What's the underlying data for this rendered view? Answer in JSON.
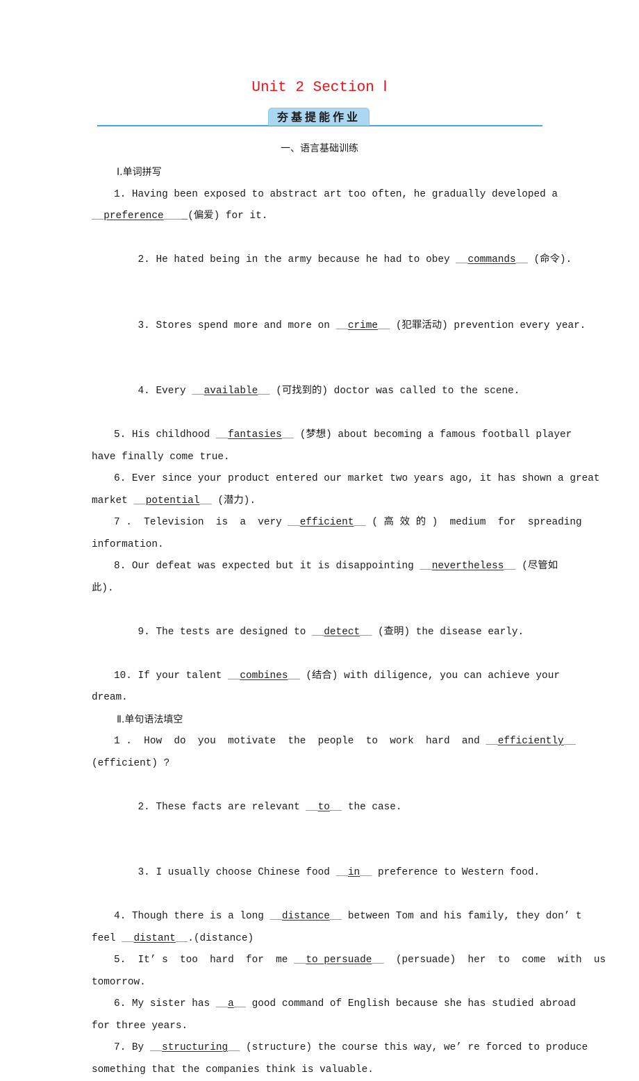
{
  "header": {
    "title": "Unit 2  Section Ⅰ",
    "banner": "夯基提能作业",
    "section_heading": "一、语言基础训练",
    "title_color": "#e8141b",
    "banner_color": "#a9d8f0",
    "rule_color": "#4aa8d8"
  },
  "part1": {
    "heading": "Ⅰ.单词拼写",
    "items": [
      {
        "pre": "1. Having been exposed to abstract art too often, he gradually developed a",
        "pre2": "",
        "answer": "preference",
        "post": "_(偏爱) for it."
      },
      {
        "pre": "2. He hated being in the army because he had to obey ",
        "answer": "commands",
        "post": " (命令)."
      },
      {
        "pre": "3. Stores spend more and more on ",
        "answer": "crime",
        "post": " (犯罪活动) prevention every year."
      },
      {
        "pre": "4. Every ",
        "answer": "available",
        "post": " (可找到的) doctor was called to the scene."
      },
      {
        "pre": "5. His childhood ",
        "answer": "fantasies",
        "post": " (梦想) about becoming a famous football player",
        "cont": "have finally come true."
      },
      {
        "pre": "6. Ever since your product entered our market two years ago, it has shown a great",
        "pre2": "market ",
        "answer": "potential",
        "post": " (潜力)."
      },
      {
        "pre": "7 .  Television  is  a  very ",
        "answer": "efficient",
        "post": " ( 高 效 的 )  medium  for  spreading",
        "cont": "information."
      },
      {
        "pre": "8. Our defeat was expected but it is disappointing ",
        "answer": "nevertheless",
        "post": " (尽管如",
        "cont": "此)."
      },
      {
        "pre": "9. The tests are designed to ",
        "answer": "detect",
        "post": " (查明) the disease early."
      },
      {
        "pre": "10. If your talent ",
        "answer": "combines",
        "post": " (结合) with diligence, you can achieve your",
        "cont": "dream."
      }
    ]
  },
  "part2": {
    "heading": "Ⅱ.单句语法填空",
    "items": [
      {
        "pre": "1 .  How  do  you  motivate  the  people  to  work  hard  and ",
        "answer": "efficiently",
        "post": "",
        "cont": "(efficient) ?"
      },
      {
        "pre": "2. These facts are relevant ",
        "answer": "to",
        "post": " the case."
      },
      {
        "pre": "3. I usually choose Chinese food ",
        "answer": "in",
        "post": " preference to Western food."
      },
      {
        "pre": "4. Though there is a long ",
        "answer": "distance",
        "post": " between Tom and his family, they don’ t",
        "cont_pre": "feel ",
        "answer2": "distant",
        "cont_post": ".(distance)"
      },
      {
        "pre": "5.  It’ s  too  hard  for  me ",
        "answer": "to persuade",
        "post": "  (persuade)  her  to  come  with  us",
        "cont": "tomorrow."
      },
      {
        "pre": "6. My sister has ",
        "answer": "a",
        "post": " good command of English because she has studied abroad",
        "cont": "for three years."
      },
      {
        "pre": "7. By ",
        "answer": "structuring",
        "post": " (structure) the course this way, we’ re forced to produce",
        "cont": "something that the companies think is valuable."
      }
    ]
  }
}
